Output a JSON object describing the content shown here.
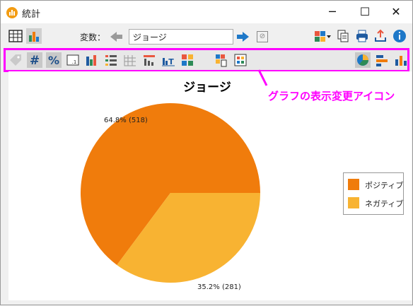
{
  "window": {
    "title": "統計"
  },
  "toolbar": {
    "variable_label": "変数：",
    "variable_value": "ジョージ"
  },
  "callout": {
    "text": "グラフの表示変更アイコン"
  },
  "colors": {
    "accent": "#ff00ff",
    "positive": "#f07c0c",
    "negative": "#f8b332",
    "blue": "#1e78c8"
  },
  "chart_data": {
    "type": "pie",
    "title": "ジョージ",
    "categories": [
      "ポジティブ",
      "ネガティブ"
    ],
    "values": [
      518,
      281
    ],
    "labels": [
      "64.8% (518)",
      "35.2% (281)"
    ],
    "legend": "right"
  }
}
